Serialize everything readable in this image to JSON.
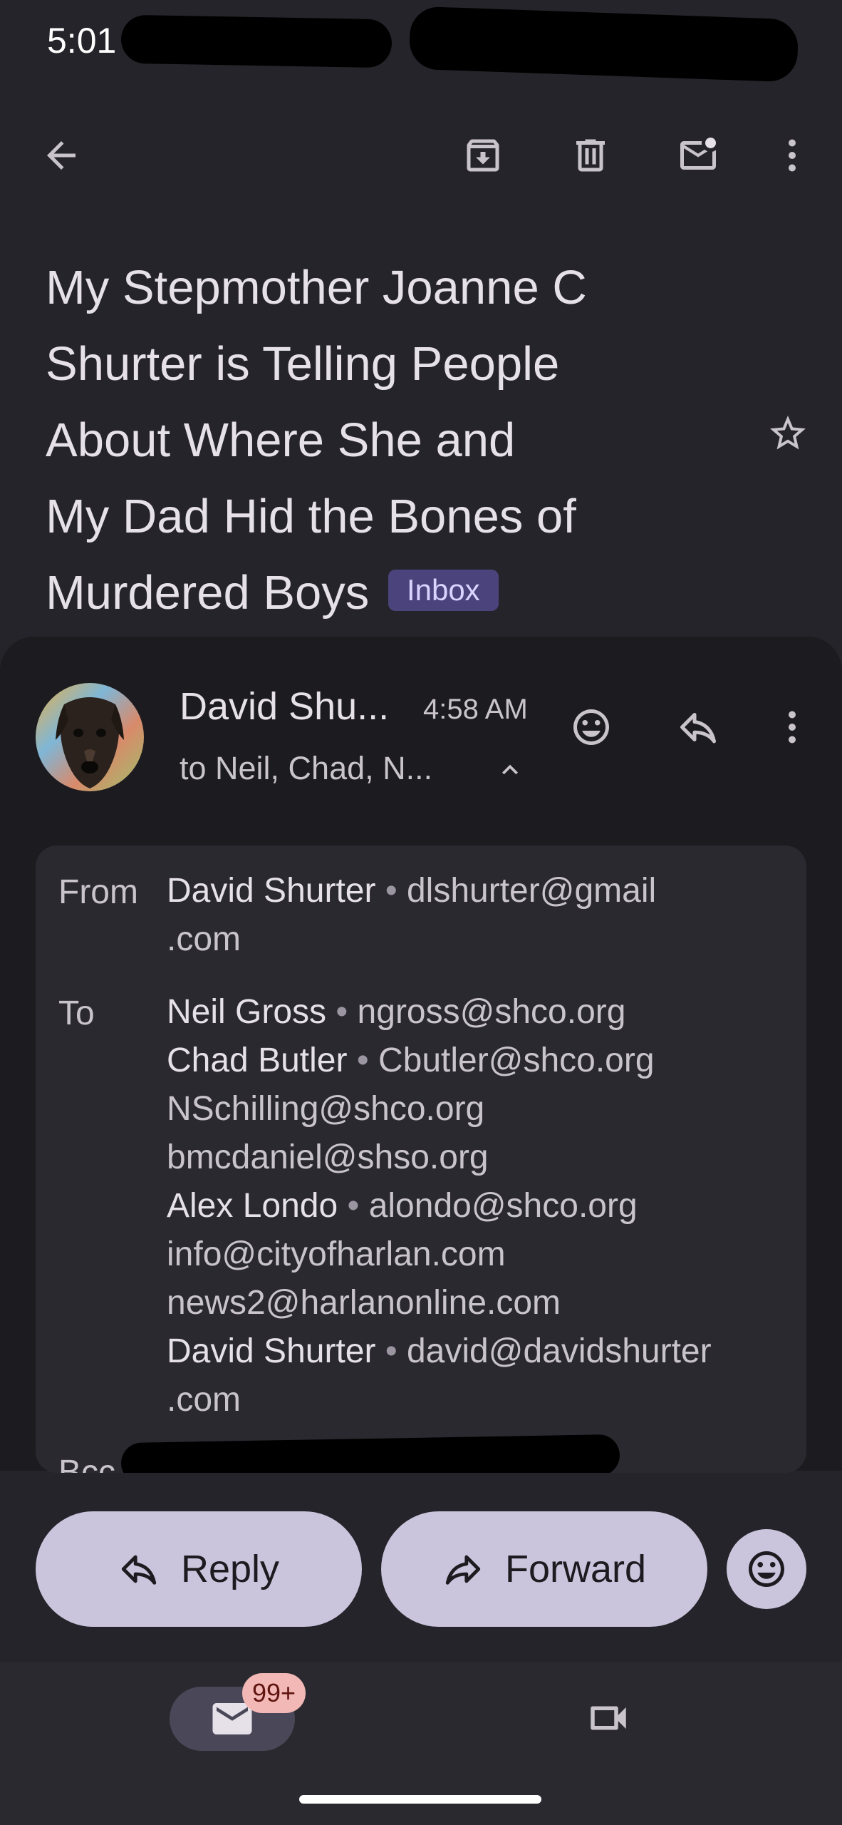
{
  "status_bar": {
    "time": "5:01"
  },
  "toolbar": {
    "back": "back-arrow-icon",
    "archive": "archive-icon",
    "delete": "trash-icon",
    "mark_unread": "mark-unread-icon",
    "more": "more-vert-icon"
  },
  "email": {
    "subject": "My Stepmother Joanne C Shurter is Telling People About Where She and My Dad Hid the Bones of Murdered Boys",
    "subject_lines": [
      "My Stepmother Joanne C",
      "Shurter is Telling People",
      "About Where She and",
      "My Dad Hid the Bones of",
      "Murdered Boys"
    ],
    "label": "Inbox",
    "sender": {
      "name_short": "David Shu...",
      "time": "4:58 AM",
      "to_short": "to Neil, Chad, N..."
    },
    "details": {
      "from_label": "From",
      "to_label": "To",
      "from": {
        "name": "David Shurter",
        "email_line1": "dlshurter@gmail",
        "email_line2": ".com"
      },
      "to": [
        {
          "name": "Neil Gross",
          "email": "ngross@shco.org"
        },
        {
          "name": "Chad Butler",
          "email": "Cbutler@shco.org"
        },
        {
          "name": "",
          "email": "NSchilling@shco.org"
        },
        {
          "name": "",
          "email": "bmcdaniel@shso.org"
        },
        {
          "name": "Alex Londo",
          "email": "alondo@shco.org"
        },
        {
          "name": "",
          "email": "info@cityofharlan.com"
        },
        {
          "name": "",
          "email": "news2@harlanonline.com"
        },
        {
          "name": "David Shurter",
          "email": "david@davidshurter"
        }
      ],
      "to_last_continuation": ".com",
      "bcc_label_partial": "Bcc"
    }
  },
  "actions": {
    "reply": "Reply",
    "forward": "Forward"
  },
  "bottom_nav": {
    "mail_badge": "99+"
  },
  "colors": {
    "background": "#25242a",
    "card": "#1c1b1f",
    "pill": "#cac4dc",
    "inbox_badge": "#4b437c",
    "notification_badge": "#f2b8b5"
  }
}
